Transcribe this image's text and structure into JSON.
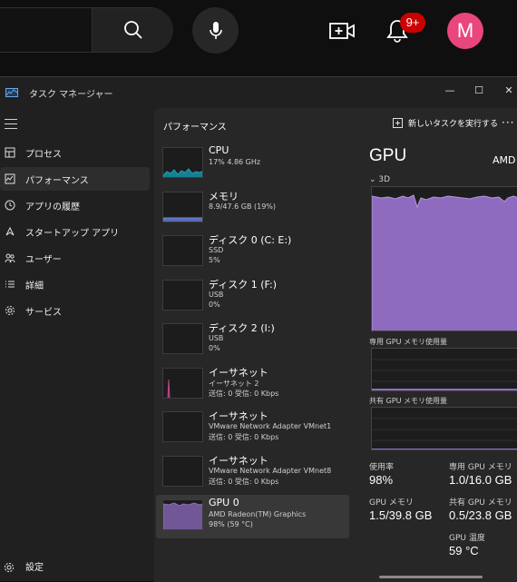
{
  "browser": {
    "notification_badge": "9+",
    "avatar_letter": "M",
    "accent": "#e8467c"
  },
  "window": {
    "title": "タスク マネージャー",
    "controls": {
      "minimize": "—",
      "maximize": "☐",
      "close": "✕"
    }
  },
  "nav": {
    "items": [
      {
        "label": "プロセス",
        "icon": "processes-icon"
      },
      {
        "label": "パフォーマンス",
        "icon": "performance-icon"
      },
      {
        "label": "アプリの履歴",
        "icon": "history-icon"
      },
      {
        "label": "スタートアップ アプリ",
        "icon": "startup-icon"
      },
      {
        "label": "ユーザー",
        "icon": "users-icon"
      },
      {
        "label": "詳細",
        "icon": "details-icon"
      },
      {
        "label": "サービス",
        "icon": "services-icon"
      }
    ],
    "settings_label": "設定"
  },
  "header": {
    "title": "パフォーマンス",
    "new_task_label": "新しいタスクを実行する",
    "more_label": "···"
  },
  "devices": [
    {
      "name": "CPU",
      "lines": [
        "17%  4.86 GHz"
      ],
      "color": "#17a0b8"
    },
    {
      "name": "メモリ",
      "lines": [
        "8.9/47.6 GB (19%)"
      ],
      "color": "#6f88e6"
    },
    {
      "name": "ディスク 0 (C: E:)",
      "lines": [
        "SSD",
        "5%"
      ],
      "color": "#3aa655"
    },
    {
      "name": "ディスク 1 (F:)",
      "lines": [
        "USB",
        "0%"
      ],
      "color": "#3aa655"
    },
    {
      "name": "ディスク 2 (I:)",
      "lines": [
        "USB",
        "0%"
      ],
      "color": "#3aa655"
    },
    {
      "name": "イーサネット",
      "lines": [
        "イーサネット 2",
        "送信: 0 受信: 0 Kbps"
      ],
      "color": "#c2418f"
    },
    {
      "name": "イーサネット",
      "lines": [
        "VMware Network Adapter VMnet1",
        "送信: 0 受信: 0 Kbps"
      ],
      "color": "#c2418f"
    },
    {
      "name": "イーサネット",
      "lines": [
        "VMware Network Adapter VMnet8",
        "送信: 0 受信: 0 Kbps"
      ],
      "color": "#c2418f"
    },
    {
      "name": "GPU 0",
      "lines": [
        "AMD Radeon(TM) Graphics",
        "98% (59 °C)"
      ],
      "color": "#8e6bbf"
    }
  ],
  "gpu": {
    "title": "GPU",
    "vendor": "AMD",
    "engine_label": "⌄ 3D",
    "dedicated_label": "専用 GPU メモリ使用量",
    "shared_label": "共有 GPU メモリ使用量",
    "fill_color": "#8e6bbf",
    "stats": {
      "usage_label": "使用率",
      "usage_value": "98%",
      "dedicated_mem_label": "専用 GPU メモリ",
      "dedicated_mem_value": "1.0/16.0 GB",
      "gpu_mem_label": "GPU メモリ",
      "gpu_mem_value": "1.5/39.8 GB",
      "shared_mem_label": "共有 GPU メモリ",
      "shared_mem_value": "0.5/23.8 GB",
      "temp_label": "GPU 温度",
      "temp_value": "59 °C"
    }
  }
}
